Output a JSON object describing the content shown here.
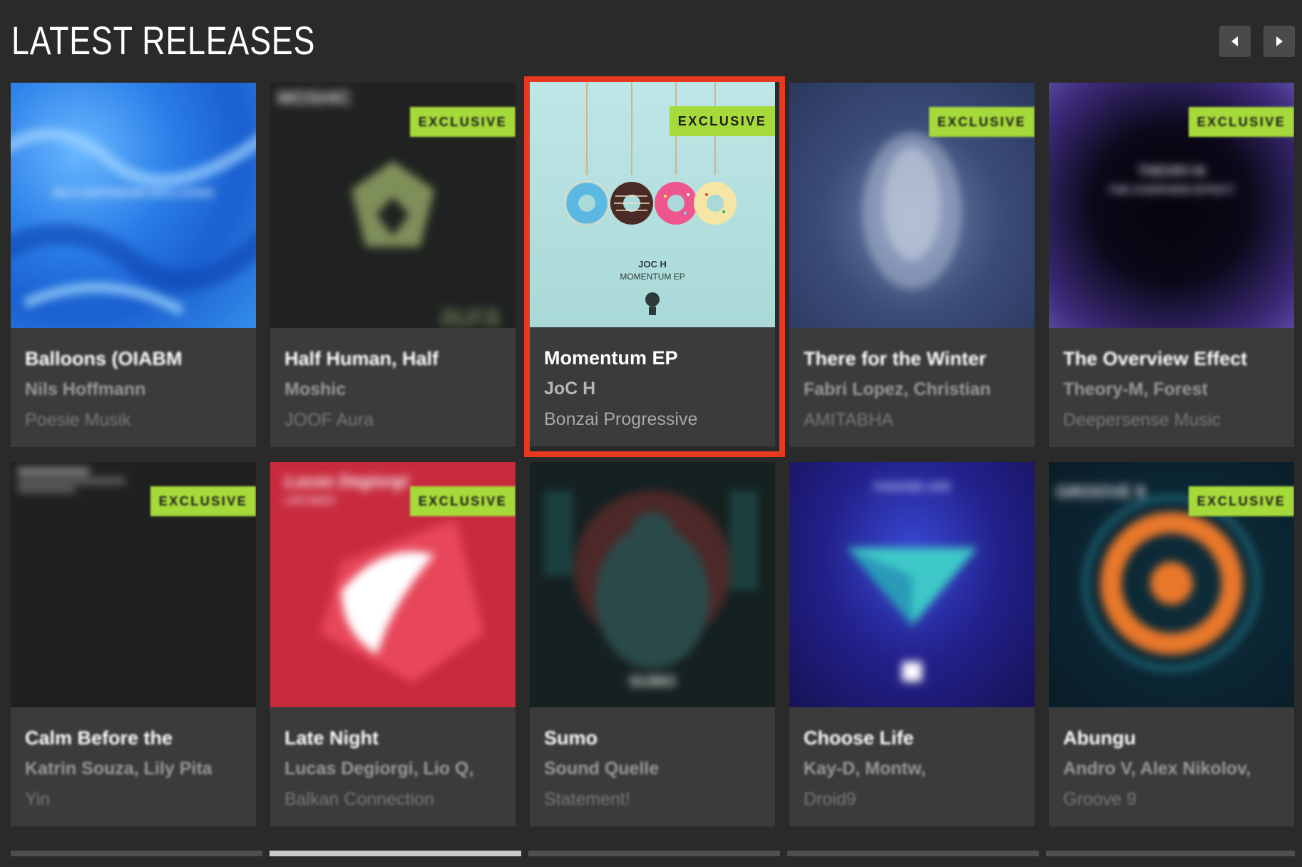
{
  "header": {
    "title": "LATEST RELEASES",
    "prev_icon": "chevron-left-icon",
    "next_icon": "chevron-right-icon"
  },
  "badge_label": "EXCLUSIVE",
  "accent_color": "#a6d93a",
  "highlight_color": "#e53a1f",
  "releases": [
    {
      "title": "Balloons (OIABM",
      "artist": "Nils Hoffmann",
      "label": "Poesie Musik",
      "exclusive": false,
      "cover_text": "NILS HOFFMANN BALLOONS"
    },
    {
      "title": "Half Human, Half",
      "artist": "Moshic",
      "label": "JOOF Aura",
      "exclusive": true,
      "cover_text": "MOSHIC",
      "cover_logo": "aura"
    },
    {
      "title": "Momentum EP",
      "artist": "JoC H",
      "label": "Bonzai Progressive",
      "exclusive": true,
      "cover_text": "JOC H",
      "cover_sub": "MOMENTUM EP"
    },
    {
      "title": "There for the Winter",
      "artist": "Fabri Lopez, Christian",
      "label": "AMITABHA",
      "exclusive": true
    },
    {
      "title": "The Overview Effect",
      "artist": "Theory-M, Forest",
      "label": "Deepersense Music",
      "exclusive": true,
      "cover_text": "THEORY-M",
      "cover_sub": "THE OVERVIEW EFFECT"
    },
    {
      "title": "Calm Before the",
      "artist": "Katrin Souza, Lily Pita",
      "label": "Yin",
      "exclusive": true
    },
    {
      "title": "Late Night",
      "artist": "Lucas Degiorgi, Lio Q,",
      "label": "Balkan Connection",
      "exclusive": true,
      "cover_text": "Lucas Degiorgi",
      "cover_sub": "LATE NIGHT"
    },
    {
      "title": "Sumo",
      "artist": "Sound Quelle",
      "label": "Statement!",
      "exclusive": false,
      "cover_text": "SUMO"
    },
    {
      "title": "Choose Life",
      "artist": "Kay-D, Montw,",
      "label": "Droid9",
      "exclusive": false,
      "cover_text": "CHOOSE LIFE"
    },
    {
      "title": "Abungu",
      "artist": "Andro V, Alex Nikolov,",
      "label": "Groove 9",
      "exclusive": true,
      "cover_text": "GROOVE 9"
    }
  ],
  "pagination": {
    "pages": 5,
    "current": 2
  }
}
